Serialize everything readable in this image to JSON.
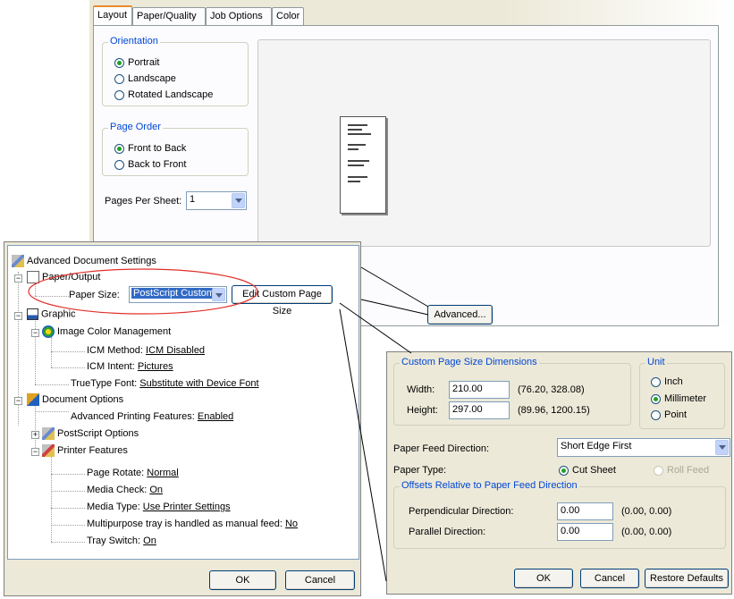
{
  "layout_dialog": {
    "tabs": [
      "Layout",
      "Paper/Quality",
      "Job Options",
      "Color"
    ],
    "orientation": {
      "label": "Orientation",
      "options": [
        "Portrait",
        "Landscape",
        "Rotated Landscape"
      ],
      "selected": "Portrait"
    },
    "page_order": {
      "label": "Page Order",
      "options": [
        "Front to Back",
        "Back to Front"
      ],
      "selected": "Front to Back"
    },
    "pages_per_sheet": {
      "label": "Pages Per Sheet:",
      "value": "1"
    },
    "advanced_button": "Advanced..."
  },
  "advanced_dialog": {
    "root": "Advanced Document Settings",
    "paper_output": {
      "label": "Paper/Output",
      "paper_size_label": "Paper Size:",
      "paper_size_value": "PostScript Custom",
      "edit_button": "Edit Custom Page Size"
    },
    "graphic": {
      "label": "Graphic",
      "icm": {
        "label": "Image Color Management",
        "method_label": "ICM Method:",
        "method_value": "ICM Disabled",
        "intent_label": "ICM Intent:",
        "intent_value": "Pictures"
      },
      "truetype_label": "TrueType Font:",
      "truetype_value": "Substitute with Device Font"
    },
    "document_options": {
      "label": "Document Options",
      "advanced_printing_label": "Advanced Printing Features:",
      "advanced_printing_value": "Enabled",
      "postscript_options": "PostScript Options",
      "printer_features": {
        "label": "Printer Features",
        "items": [
          {
            "label": "Page Rotate:",
            "value": "Normal"
          },
          {
            "label": "Media Check:",
            "value": "On"
          },
          {
            "label": "Media Type:",
            "value": "Use Printer Settings"
          },
          {
            "label": "Multipurpose tray is handled as manual feed:",
            "value": "No"
          },
          {
            "label": "Tray Switch:",
            "value": "On"
          }
        ]
      }
    },
    "ok_button": "OK",
    "cancel_button": "Cancel"
  },
  "custom_dialog": {
    "dimensions": {
      "label": "Custom Page Size Dimensions",
      "width_label": "Width:",
      "width_value": "210.00",
      "width_range": "(76.20, 328.08)",
      "height_label": "Height:",
      "height_value": "297.00",
      "height_range": "(89.96, 1200.15)"
    },
    "unit": {
      "label": "Unit",
      "options": [
        "Inch",
        "Millimeter",
        "Point"
      ],
      "selected": "Millimeter"
    },
    "feed_direction_label": "Paper Feed Direction:",
    "feed_direction_value": "Short Edge First",
    "paper_type_label": "Paper Type:",
    "paper_type_options": [
      "Cut Sheet",
      "Roll Feed"
    ],
    "paper_type_selected": "Cut Sheet",
    "offsets": {
      "label": "Offsets Relative to Paper Feed Direction",
      "perpendicular_label": "Perpendicular Direction:",
      "perpendicular_value": "0.00",
      "perpendicular_range": "(0.00, 0.00)",
      "parallel_label": "Parallel Direction:",
      "parallel_value": "0.00",
      "parallel_range": "(0.00, 0.00)"
    },
    "ok_button": "OK",
    "cancel_button": "Cancel",
    "restore_button": "Restore Defaults"
  },
  "colors": {
    "dialog_bg": "#ece9d8",
    "group_label": "#0046d5",
    "highlight_ellipse": "#e0302a",
    "selection": "#316ac5"
  }
}
